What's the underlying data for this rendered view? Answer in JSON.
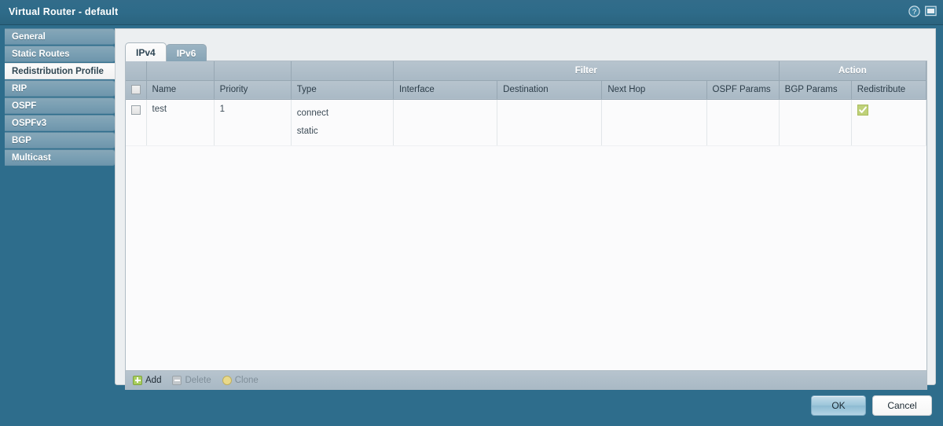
{
  "window": {
    "title": "Virtual Router - default",
    "help_icon": "help-circle-icon",
    "restore_icon": "window-restore-icon"
  },
  "sidebar": {
    "items": [
      {
        "label": "General",
        "active": false
      },
      {
        "label": "Static Routes",
        "active": false
      },
      {
        "label": "Redistribution Profile",
        "active": true
      },
      {
        "label": "RIP",
        "active": false
      },
      {
        "label": "OSPF",
        "active": false
      },
      {
        "label": "OSPFv3",
        "active": false
      },
      {
        "label": "BGP",
        "active": false
      },
      {
        "label": "Multicast",
        "active": false
      }
    ]
  },
  "tabs": [
    {
      "label": "IPv4",
      "active": true
    },
    {
      "label": "IPv6",
      "active": false
    }
  ],
  "table": {
    "group_headers": [
      {
        "label": "",
        "span": 3
      },
      {
        "label": "Filter",
        "span": 5
      },
      {
        "label": "Action",
        "span": 1
      }
    ],
    "columns": [
      "Name",
      "Priority",
      "Type",
      "Interface",
      "Destination",
      "Next Hop",
      "OSPF Params",
      "BGP Params",
      "Redistribute"
    ],
    "select_all_checked": false,
    "rows": [
      {
        "checked": false,
        "name": "test",
        "priority": "1",
        "type": [
          "connect",
          "static"
        ],
        "interface": "",
        "destination": "",
        "next_hop": "",
        "ospf_params": "",
        "bgp_params": "",
        "redistribute_checked": true
      }
    ]
  },
  "grid_toolbar": {
    "buttons": [
      {
        "label": "Add",
        "icon": "plus-icon",
        "enabled": true
      },
      {
        "label": "Delete",
        "icon": "minus-icon",
        "enabled": false
      },
      {
        "label": "Clone",
        "icon": "clone-icon",
        "enabled": false
      }
    ]
  },
  "dialog_buttons": {
    "ok": "OK",
    "cancel": "Cancel"
  },
  "colors": {
    "title_bar": "#2e6d8c",
    "sidebar_item": "#7ba0b4",
    "header_row": "#aebcc7",
    "checkbox_green": "#bfd179",
    "add_icon_green": "#a9cf5e",
    "clone_icon_yellow": "#e9d98a",
    "ok_button": "#9dc6da"
  }
}
